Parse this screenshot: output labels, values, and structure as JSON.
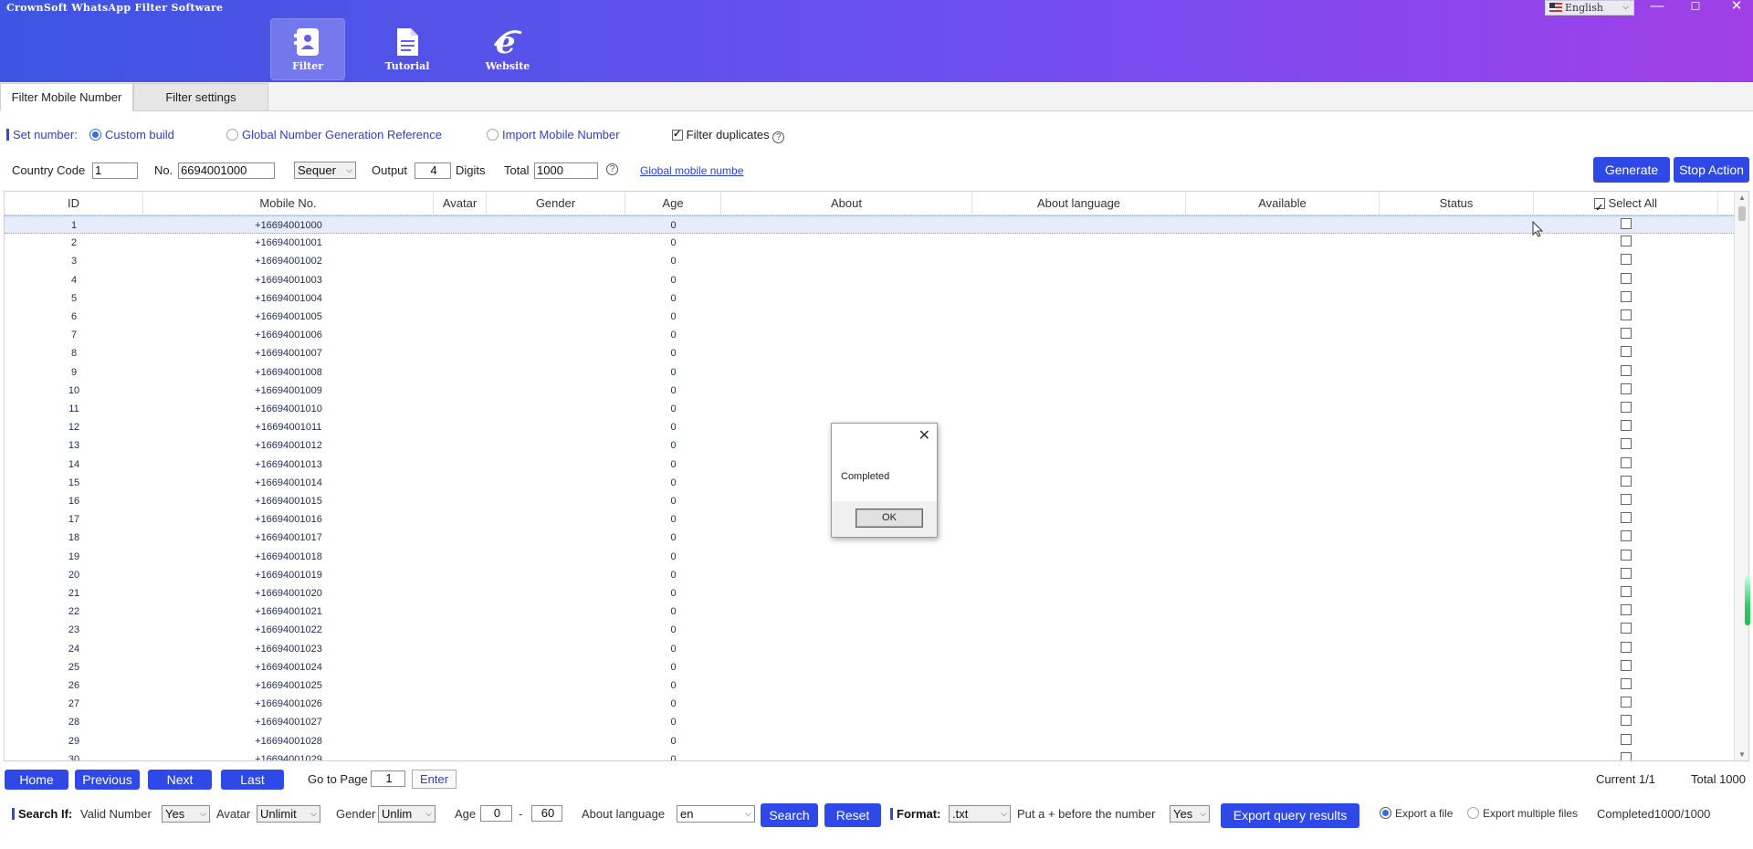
{
  "app": {
    "title": "CrownSoft WhatsApp Filter Software",
    "language": "English",
    "window_controls": {
      "minimize": "—",
      "maximize": "☐",
      "close": "✕"
    }
  },
  "nav": [
    {
      "label": "Filter",
      "icon": "contact-card-icon",
      "active": true
    },
    {
      "label": "Tutorial",
      "icon": "document-icon",
      "active": false
    },
    {
      "label": "Website",
      "icon": "internet-explorer-icon",
      "active": false
    }
  ],
  "tabs": [
    {
      "label": "Filter Mobile Number",
      "active": true
    },
    {
      "label": "Filter settings",
      "active": false
    }
  ],
  "set_number": {
    "label": "Set number:",
    "options": [
      "Custom build",
      "Global Number Generation Reference",
      "Import Mobile Number"
    ],
    "selected": "Custom build",
    "filter_duplicates_label": "Filter duplicates",
    "filter_duplicates_checked": true
  },
  "generate_row": {
    "country_code_label": "Country Code",
    "country_code_value": "1",
    "no_label": "No.",
    "no_value": "6694001000",
    "mode_value": "Sequer",
    "output_label": "Output",
    "output_value": "4",
    "digits_label": "Digits",
    "total_label": "Total",
    "total_value": "1000",
    "global_link": "Global mobile numbe",
    "generate_button": "Generate",
    "stop_button": "Stop Action"
  },
  "table": {
    "columns": [
      "ID",
      "Mobile No.",
      "Avatar",
      "Gender",
      "Age",
      "About",
      "About language",
      "Available",
      "Status",
      "Select All"
    ],
    "select_all_checked": true,
    "rows": [
      {
        "id": "1",
        "mobile": "+16694001000",
        "age": "0"
      },
      {
        "id": "2",
        "mobile": "+16694001001",
        "age": "0"
      },
      {
        "id": "3",
        "mobile": "+16694001002",
        "age": "0"
      },
      {
        "id": "4",
        "mobile": "+16694001003",
        "age": "0"
      },
      {
        "id": "5",
        "mobile": "+16694001004",
        "age": "0"
      },
      {
        "id": "6",
        "mobile": "+16694001005",
        "age": "0"
      },
      {
        "id": "7",
        "mobile": "+16694001006",
        "age": "0"
      },
      {
        "id": "8",
        "mobile": "+16694001007",
        "age": "0"
      },
      {
        "id": "9",
        "mobile": "+16694001008",
        "age": "0"
      },
      {
        "id": "10",
        "mobile": "+16694001009",
        "age": "0"
      },
      {
        "id": "11",
        "mobile": "+16694001010",
        "age": "0"
      },
      {
        "id": "12",
        "mobile": "+16694001011",
        "age": "0"
      },
      {
        "id": "13",
        "mobile": "+16694001012",
        "age": "0"
      },
      {
        "id": "14",
        "mobile": "+16694001013",
        "age": "0"
      },
      {
        "id": "15",
        "mobile": "+16694001014",
        "age": "0"
      },
      {
        "id": "16",
        "mobile": "+16694001015",
        "age": "0"
      },
      {
        "id": "17",
        "mobile": "+16694001016",
        "age": "0"
      },
      {
        "id": "18",
        "mobile": "+16694001017",
        "age": "0"
      },
      {
        "id": "19",
        "mobile": "+16694001018",
        "age": "0"
      },
      {
        "id": "20",
        "mobile": "+16694001019",
        "age": "0"
      },
      {
        "id": "21",
        "mobile": "+16694001020",
        "age": "0"
      },
      {
        "id": "22",
        "mobile": "+16694001021",
        "age": "0"
      },
      {
        "id": "23",
        "mobile": "+16694001022",
        "age": "0"
      },
      {
        "id": "24",
        "mobile": "+16694001023",
        "age": "0"
      },
      {
        "id": "25",
        "mobile": "+16694001024",
        "age": "0"
      },
      {
        "id": "26",
        "mobile": "+16694001025",
        "age": "0"
      },
      {
        "id": "27",
        "mobile": "+16694001026",
        "age": "0"
      },
      {
        "id": "28",
        "mobile": "+16694001027",
        "age": "0"
      },
      {
        "id": "29",
        "mobile": "+16694001028",
        "age": "0"
      },
      {
        "id": "30",
        "mobile": "+16694001029",
        "age": "0"
      }
    ]
  },
  "dialog": {
    "message": "Completed",
    "ok_label": "OK"
  },
  "pagination": {
    "home": "Home",
    "previous": "Previous",
    "next": "Next",
    "last": "Last",
    "go_to_page_label": "Go to Page",
    "page_value": "1",
    "enter_label": "Enter",
    "current": "Current 1/1",
    "total": "Total 1000"
  },
  "query": {
    "search_if_label": "Search If:",
    "valid_number_label": "Valid Number",
    "valid_number_value": "Yes",
    "avatar_label": "Avatar",
    "avatar_value": "Unlimit",
    "gender_label": "Gender",
    "gender_value": "Unlim",
    "age_label": "Age",
    "age_min": "0",
    "age_sep": "-",
    "age_max": "60",
    "about_language_label": "About language",
    "about_language_value": "en",
    "search_button": "Search",
    "reset_button": "Reset",
    "format_label": "Format:",
    "format_value": ".txt",
    "plus_label": "Put a + before the number",
    "plus_value": "Yes",
    "export_button": "Export query results",
    "export_file_label": "Export a file",
    "export_multiple_label": "Export multiple files",
    "export_selected": "Export a file",
    "progress_text": "Completed1000/1000"
  },
  "colors": {
    "accent": "#2f49e8",
    "header_gradient_start": "#3d55e3",
    "header_gradient_end": "#a03fe8"
  }
}
